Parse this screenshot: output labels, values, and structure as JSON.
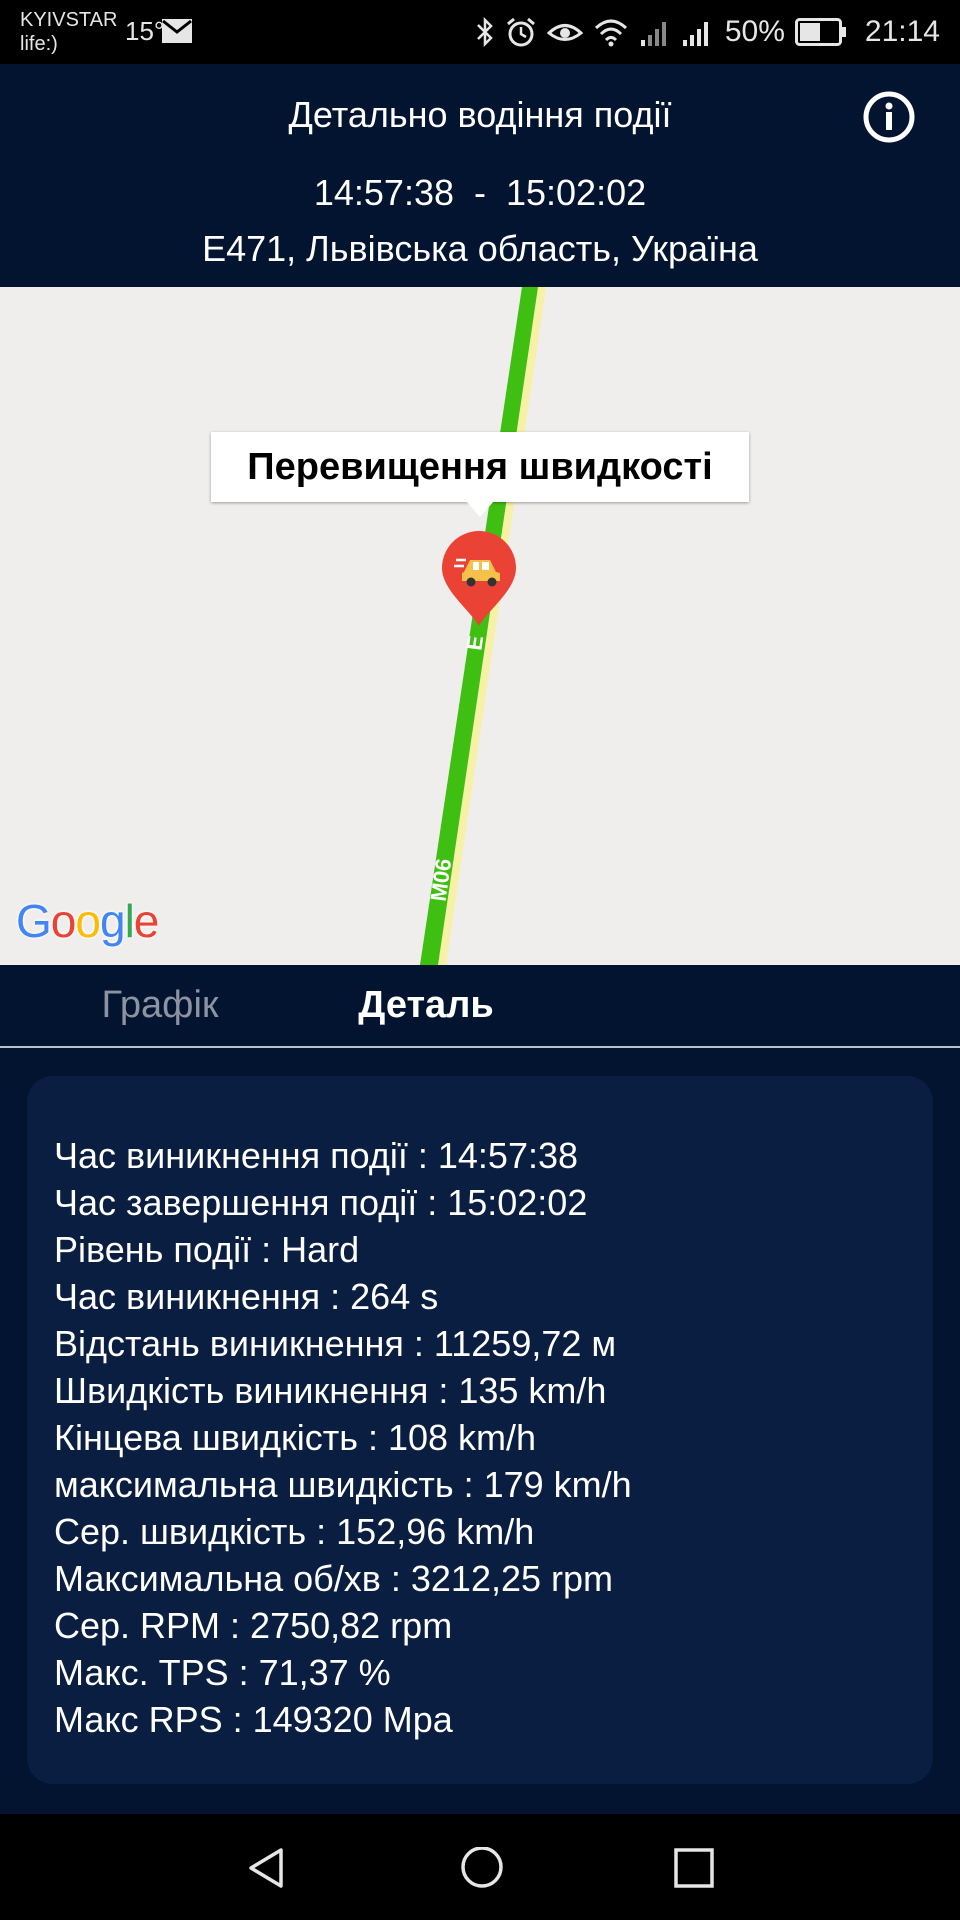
{
  "status_bar": {
    "carrier_line1": "KYIVSTAR",
    "carrier_line2": "life:)",
    "temperature": "15°",
    "battery_percent": "50%",
    "time": "21:14",
    "icons": [
      "mail-icon",
      "bluetooth-icon",
      "alarm-icon",
      "eye-icon",
      "wifi-icon",
      "signal-icon",
      "signal-icon",
      "battery-icon"
    ]
  },
  "header": {
    "title": "Детально водіння події",
    "time_range": "14:57:38  -  15:02:02",
    "location": "E471, Львівська область, Україна",
    "info_icon": "info-icon"
  },
  "map": {
    "tooltip": "Перевищення швидкості",
    "marker_icon": "car-marker-icon",
    "road_label_1": "E",
    "road_label_2": "M06",
    "logo": {
      "G": "G",
      "o1": "o",
      "o2": "o",
      "g": "g",
      "l": "l",
      "e": "e"
    },
    "colors": {
      "background": "#efeeec",
      "road": "#3fbf12",
      "road_edge": "#f7f1a6",
      "marker": "#ea4335"
    }
  },
  "tabs": {
    "chart": "Графік",
    "details": "Деталь",
    "active": "details"
  },
  "details": {
    "lines": [
      "Час виникнення події : 14:57:38",
      "Час завершення події : 15:02:02",
      "Рівень події : Hard",
      "Час виникнення : 264 s",
      "Відстань виникнення : 11259,72 м",
      "Швидкість виникнення : 135 km/h",
      "Кінцева швидкість : 108 km/h",
      "максимальна швидкість : 179 km/h",
      "Сер. швидкість : 152,96 km/h",
      "Максимальна об/хв : 3212,25 rpm",
      "Сер. RPM : 2750,82 rpm",
      "Макс. TPS : 71,37 %",
      "Макс RPS : 149320 Mpa"
    ]
  },
  "nav_bar": {
    "back_icon": "back-icon",
    "home_icon": "home-icon",
    "recent_icon": "recent-apps-icon"
  },
  "colors": {
    "header_bg": "#031431",
    "card_bg": "#0a1e41",
    "tab_inactive": "#8d93a0"
  }
}
